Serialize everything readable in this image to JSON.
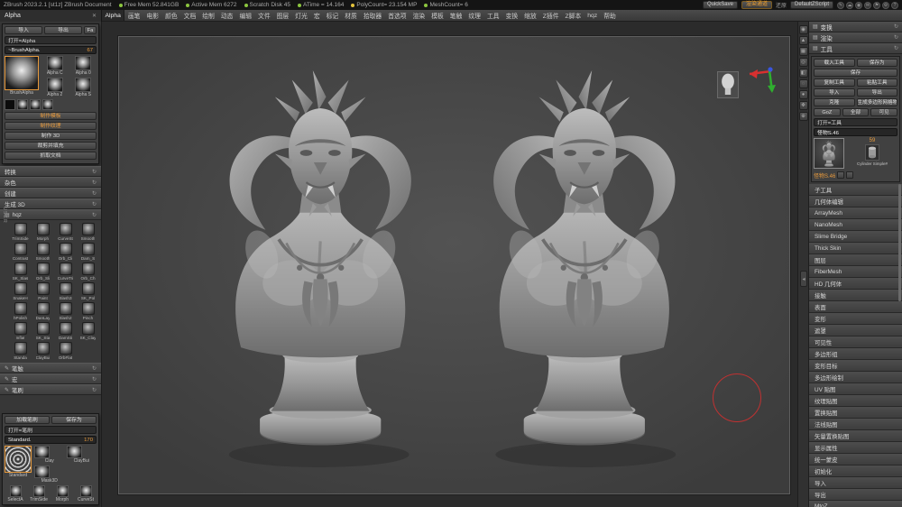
{
  "title_bar": {
    "app_title": "ZBrush 2023.2.1 [st1z]   ZBrush Document",
    "stats": [
      {
        "label": "Free Mem 52.841GB",
        "color": "#8cc63f"
      },
      {
        "label": "Active Mem 6272",
        "color": "#8cc63f"
      },
      {
        "label": "Scratch Disk 45",
        "color": "#8cc63f"
      },
      {
        "label": "ATime = 14.164",
        "color": "#8cc63f"
      },
      {
        "label": "PolyCount= 23.154 MP",
        "color": "#e3c23c"
      },
      {
        "label": "MeshCount= 6",
        "color": "#8cc63f"
      }
    ],
    "quicksave_label": "QuickSave",
    "renderpass_label": "渲染通道",
    "restore_label": "还原",
    "zscript_label": "DefaultZScript",
    "icons": [
      {
        "name": "pen-icon",
        "glyph": "✎"
      },
      {
        "name": "cloud-icon",
        "glyph": "☁"
      },
      {
        "name": "user-icon",
        "glyph": "◉"
      },
      {
        "name": "mail-icon",
        "glyph": "✉"
      },
      {
        "name": "flag-icon",
        "glyph": "⚑"
      },
      {
        "name": "gear-icon",
        "glyph": "⚙"
      },
      {
        "name": "help-icon",
        "glyph": "?"
      }
    ]
  },
  "menu_bar": {
    "items": [
      "Alpha",
      "画笔",
      "电影",
      "颜色",
      "文档",
      "绘制",
      "动态",
      "编辑",
      "文件",
      "图层",
      "灯光",
      "宏",
      "标记",
      "材质",
      "拾取器",
      "首选项",
      "渲染",
      "模板",
      "笔触",
      "纹理",
      "工具",
      "变换",
      "缩放",
      "Z插件",
      "Z脚本",
      "hqz",
      "帮助"
    ]
  },
  "alpha_popup": {
    "title": "Alpha",
    "import_label": "导入",
    "export_label": "导出",
    "flip_label": "Fa",
    "open_label": "打开=Alpha",
    "slider_label": "~BrushAlpha.",
    "slider_value": "67",
    "featured_thumb": "BrushAlpha",
    "thumbs": [
      "Alpha C",
      "Alpha 0",
      "Alpha 2",
      "Alpha S"
    ],
    "transfer_buttons": [
      "制作模板",
      "制作纹理"
    ],
    "make_buttons": [
      "制作 3D",
      "裁剪并填充",
      "抓取文档"
    ]
  },
  "left_sections": [
    "转换",
    "杂色",
    "创建",
    "生成 3D"
  ],
  "user_tab_label": "USER",
  "hqz_panel": {
    "title": "hqz",
    "brushes": [
      "TrimSide",
      "Morph",
      "CurveSt",
      "Smooth",
      "Contrast",
      "Smooth",
      "Orb_Cli",
      "Dam_S",
      "SK_Slas",
      "Orb_Sli",
      "CurveTri",
      "Orb_Ch",
      "SnakeH",
      "Paint",
      "Slash3",
      "SK_Pol",
      "hPolish",
      "DanLay",
      "Slash2",
      "Pinch",
      "Inflat",
      "SK_Sta",
      "DamSti",
      "SK_Clay",
      "Standa",
      "ClayBui",
      "OrbFlat"
    ]
  },
  "left_palettes": [
    "笔触",
    "宏",
    "笔刷"
  ],
  "brush_popup": {
    "load_label": "加载笔刷",
    "saveas_label": "保存为",
    "open_label": "打开=笔刷",
    "slider_label": "Standard.",
    "slider_value": "170",
    "featured": "Standard",
    "thumbs": [
      "Clay",
      "ClayBui",
      "Mask3D"
    ],
    "bottom_thumbs": [
      "SelectA",
      "TrimSide",
      "Morph",
      "CurveSt"
    ]
  },
  "right_shelf_icons": [
    {
      "name": "bpr-icon",
      "glyph": "◉"
    },
    {
      "name": "persp-icon",
      "glyph": "▲"
    },
    {
      "name": "floor-icon",
      "glyph": "▦"
    },
    {
      "name": "local-icon",
      "glyph": "◎"
    },
    {
      "name": "transp-icon",
      "glyph": "◧"
    },
    {
      "name": "ghost-icon",
      "glyph": "◌"
    },
    {
      "name": "solo-icon",
      "glyph": "●"
    },
    {
      "name": "scroll-icon",
      "glyph": "✥"
    },
    {
      "name": "zoom-icon",
      "glyph": "⊕"
    }
  ],
  "right_panel": {
    "palette_tabs": [
      "变换",
      "渲染",
      "工具"
    ],
    "tool": {
      "load_label": "载入工具",
      "saveas_label": "保存为",
      "save_label": "保存",
      "copy_label": "复制工具",
      "paste_label": "粘贴工具",
      "import_label": "导入",
      "export_label": "导出",
      "clone_label": "克隆",
      "makepoly_label": "生成多边形网格物体",
      "goz_label": "GoZ",
      "all_label": "全部",
      "visible_label": "可见",
      "open_label": "打开=工具",
      "slider_label": "怪物S.46",
      "tool_count": "59",
      "secondary_thumb": "Cylinder Simple#",
      "active_name": "怪物S.46"
    },
    "sections": [
      "子工具",
      "几何体编辑",
      "ArrayMesh",
      "NanoMesh",
      "Slime Bridge",
      "Thick Skin",
      "图层",
      "FiberMesh",
      "HD 几何体",
      "接触",
      "表面",
      "变形",
      "遮罩",
      "可见性",
      "多边形组",
      "变形目标",
      "多边形绘制",
      "UV 贴图",
      "纹理贴图",
      "置换贴图",
      "法线贴图",
      "矢量置换贴图",
      "显示属性",
      "统一蒙皮",
      "初始化",
      "导入",
      "导出",
      "MtoZ"
    ]
  }
}
